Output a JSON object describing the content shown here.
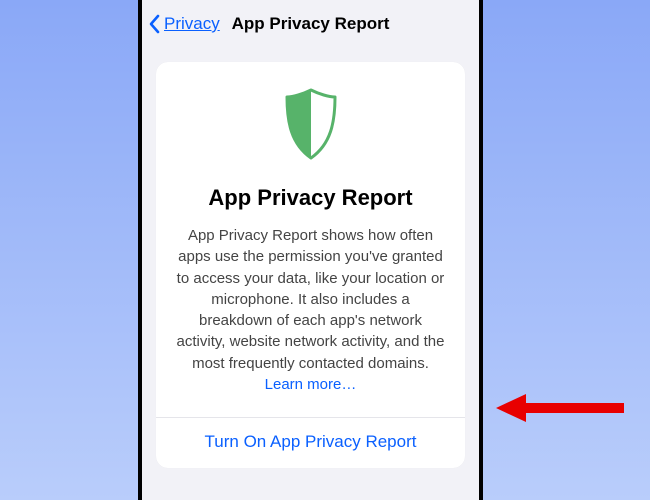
{
  "nav": {
    "back_label": "Privacy",
    "title": "App Privacy Report"
  },
  "card": {
    "title": "App Privacy Report",
    "description": "App Privacy Report shows how often apps use the permission you've granted to access your data, like your location or microphone. It also includes a breakdown of each app's network activity, website network activity, and the most frequently contacted domains. ",
    "learn_more": "Learn more…",
    "action": "Turn On App Privacy Report"
  },
  "colors": {
    "accent": "#0a60ff",
    "shield": "#57b36a"
  }
}
